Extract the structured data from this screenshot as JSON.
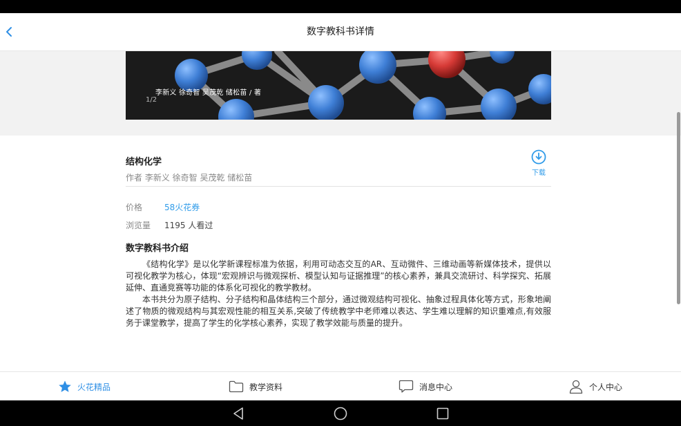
{
  "header": {
    "title": "数字教科书详情",
    "back_icon": "chevron-left-icon"
  },
  "banner": {
    "caption": "李新义 徐奇智 吴茂乾 储松苗 / 著",
    "page_indicator": "1/2"
  },
  "book": {
    "title": "结构化学",
    "author": "作者 李新义 徐奇智 吴茂乾 储松苗",
    "download_label": "下载",
    "download_icon": "download-circle-icon"
  },
  "info": {
    "price_label": "价格",
    "price_value": "58火花券",
    "views_label": "浏览量",
    "views_value": "1195 人看过"
  },
  "intro": {
    "title": "数字教科书介绍",
    "paragraphs": [
      "《结构化学》是以化学新课程标准为依据，利用可动态交互的AR、互动微件、三维动画等新媒体技术，提供以可视化教学为核心，体现“宏观辨识与微观探析、模型认知与证据推理”的核心素养，兼具交流研讨、科学探究、拓展延伸、直通竞赛等功能的体系化可视化的教学教材。",
      "本书共分为原子结构、分子结构和晶体结构三个部分，通过微观结构可视化、抽象过程具体化等方式，形象地阐述了物质的微观结构与其宏观性能的相互关系,突破了传统教学中老师难以表达、学生难以理解的知识重难点,有效服务于课堂教学，提高了学生的化学核心素养，实现了教学效能与质量的提升。"
    ]
  },
  "tabbar": {
    "tabs": [
      {
        "label": "火花精品",
        "icon": "star-icon",
        "active": true
      },
      {
        "label": "教学资料",
        "icon": "folder-icon",
        "active": false
      },
      {
        "label": "消息中心",
        "icon": "chat-bubble-icon",
        "active": false
      },
      {
        "label": "个人中心",
        "icon": "person-icon",
        "active": false
      }
    ]
  },
  "colors": {
    "accent": "#2f8fe5",
    "link": "#2f9be9",
    "banner_bg": "#1b1b1b",
    "atom_blue": "#3f7fd6",
    "atom_red": "#d63a36"
  }
}
